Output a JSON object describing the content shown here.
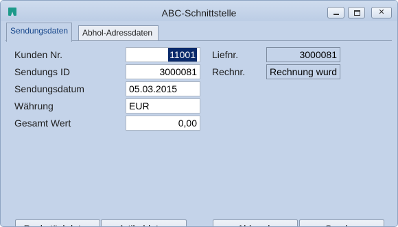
{
  "window": {
    "title": "ABC-Schnittstelle"
  },
  "caption_buttons": {
    "minimize": "",
    "maximize": "",
    "close": "✕"
  },
  "tabs": [
    {
      "label": "Sendungsdaten",
      "active": true
    },
    {
      "label": "Abhol-Adressdaten",
      "active": false
    }
  ],
  "form": {
    "kunden_nr": {
      "label": "Kunden Nr.",
      "value": "11001"
    },
    "sendungs_id": {
      "label": "Sendungs ID",
      "value": "3000081"
    },
    "sendungsdatum": {
      "label": "Sendungsdatum",
      "value": "05.03.2015"
    },
    "waehrung": {
      "label": "Währung",
      "value": "EUR"
    },
    "gesamt_wert": {
      "label": "Gesamt Wert",
      "value": "0,00"
    },
    "liefnr": {
      "label": "Liefnr.",
      "value": "3000081"
    },
    "rechnr": {
      "label": "Rechnr.",
      "value": "Rechnung wurd"
    }
  },
  "buttons": {
    "packstueckdaten": "Packstückdaten",
    "artikeldaten": "Artikeldaten",
    "abbruch": "Abbruch",
    "senden": "Senden"
  },
  "colors": {
    "background": "#c4d3e9",
    "selection": "#0a2a6b",
    "active_tab_text": "#15458a"
  }
}
